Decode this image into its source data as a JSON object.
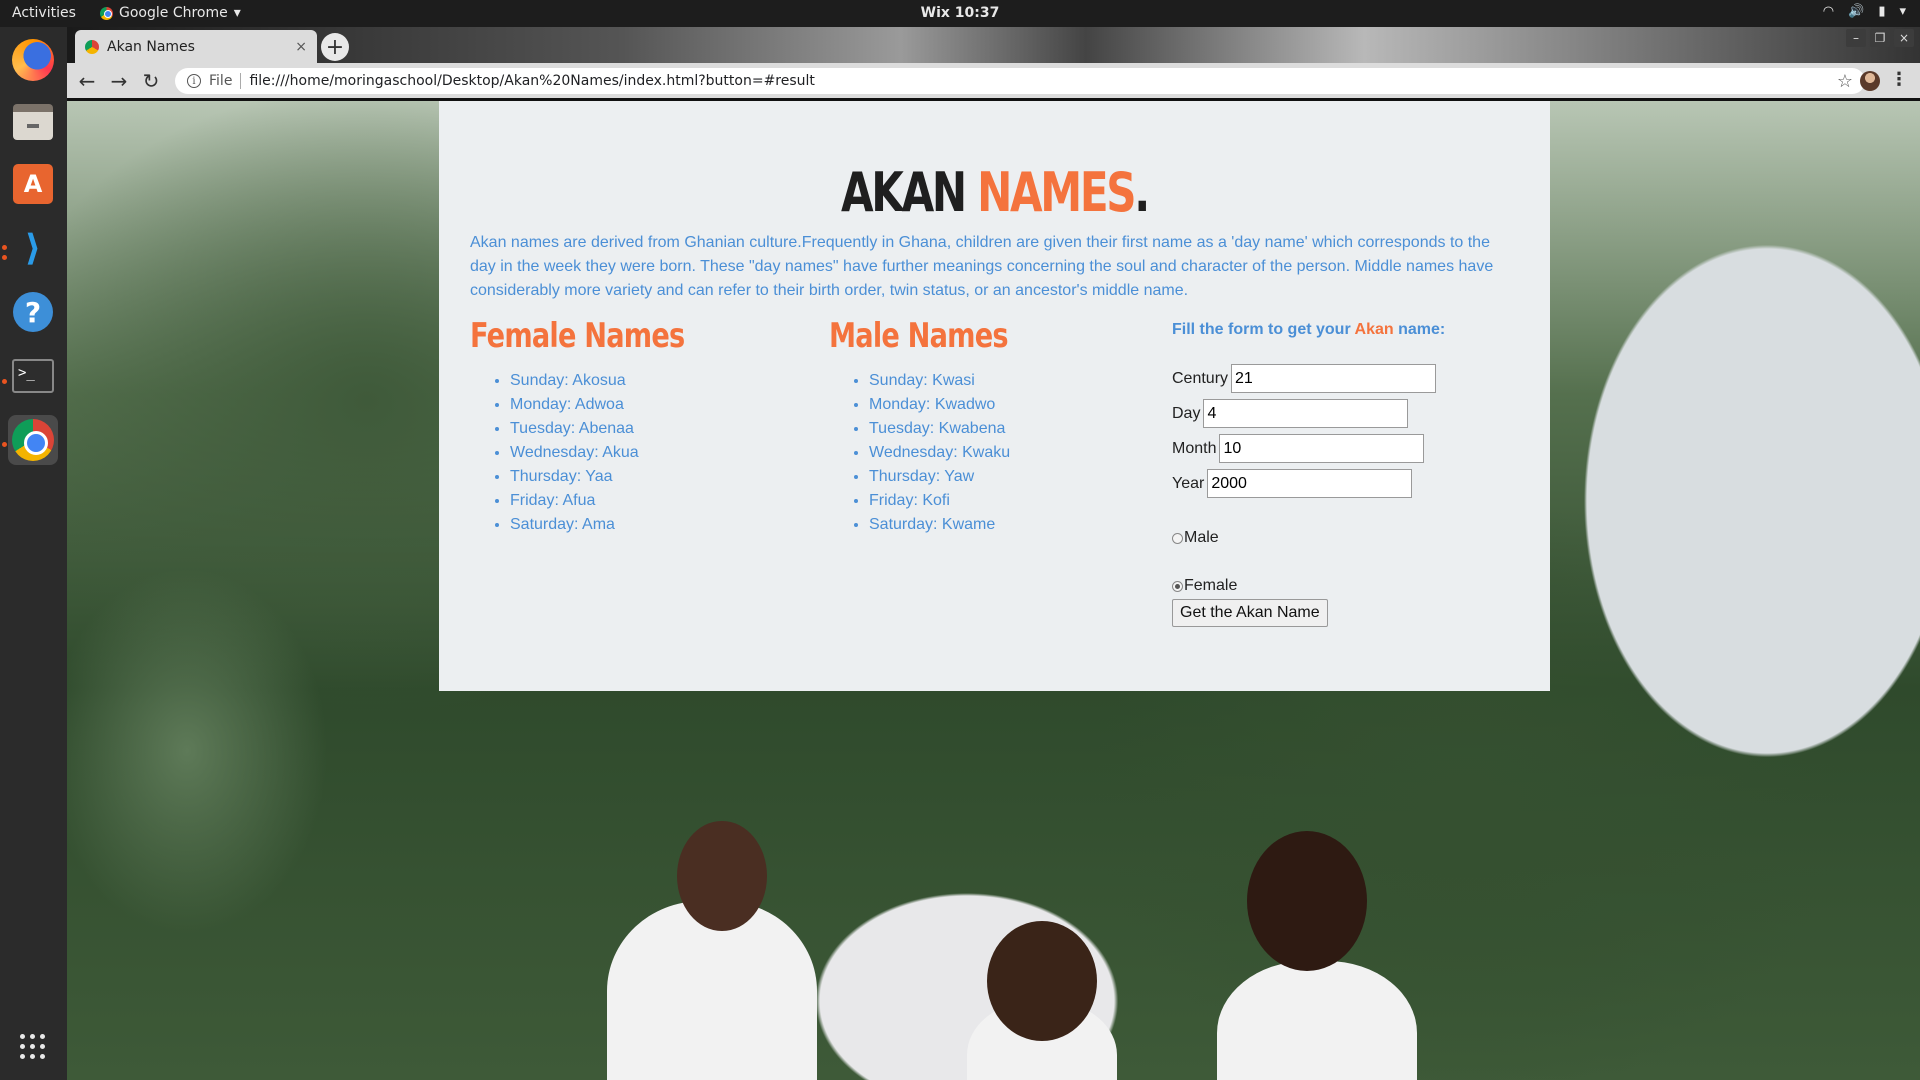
{
  "system": {
    "activities": "Activities",
    "app_name": "Google Chrome",
    "clock": "Wix 10:37"
  },
  "browser": {
    "tab_title": "Akan Names",
    "url_scheme": "File",
    "url": "file:///home/moringaschool/Desktop/Akan%20Names/index.html?button=#result"
  },
  "page": {
    "title_part1": "AKAN",
    "title_part2": "NAMES",
    "title_part3": ".",
    "intro": "Akan names are derived from Ghanian culture.Frequently in Ghana, children are given their first name as a 'day name' which corresponds to the day in the week they were born. These \"day names\" have further meanings concerning the soul and character of the person. Middle names have considerably more variety and can refer to their birth order, twin status, or an ancestor's middle name.",
    "female": {
      "heading": "Female Names",
      "items": [
        "Sunday: Akosua",
        "Monday: Adwoa",
        "Tuesday: Abenaa",
        "Wednesday: Akua",
        "Thursday: Yaa",
        "Friday: Afua",
        "Saturday: Ama"
      ]
    },
    "male": {
      "heading": "Male Names",
      "items": [
        "Sunday: Kwasi",
        "Monday: Kwadwo",
        "Tuesday: Kwabena",
        "Wednesday: Kwaku",
        "Thursday: Yaw",
        "Friday: Kofi",
        "Saturday: Kwame"
      ]
    },
    "form": {
      "heading_pre": "Fill the form to get your ",
      "heading_accent": "Akan",
      "heading_post": " name:",
      "century_label": "Century",
      "century_value": "21",
      "day_label": "Day",
      "day_value": "4",
      "month_label": "Month",
      "month_value": "10",
      "year_label": "Year",
      "year_value": "2000",
      "male_label": "Male",
      "female_label": "Female",
      "selected_gender": "Female",
      "submit_label": "Get the Akan Name"
    }
  },
  "colors": {
    "accent_orange": "#f4733d",
    "text_blue": "#4b8fd6",
    "card_bg": "#eceff1"
  },
  "icons": [
    "firefox-icon",
    "files-icon",
    "software-store-icon",
    "vscode-icon",
    "help-icon",
    "terminal-icon",
    "chrome-icon",
    "app-grid-icon"
  ]
}
